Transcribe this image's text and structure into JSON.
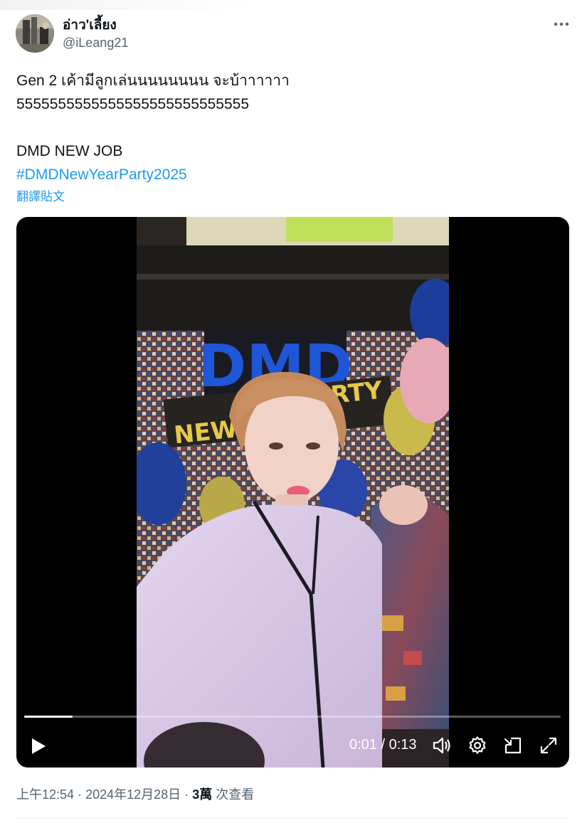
{
  "author": {
    "display_name": "อ่าว'เลี้ยง",
    "handle": "@iLeang21"
  },
  "icons": {
    "more": "more-horizontal-icon",
    "play": "play-icon",
    "volume": "volume-icon",
    "settings": "gear-icon",
    "pip": "picture-in-picture-icon",
    "fullscreen": "fullscreen-icon"
  },
  "tweet": {
    "lines": [
      "Gen 2 เค้ามีลูกเล่นนนนนนนน จะบ้าาาาาา",
      "5555555555555555555555555555",
      "",
      "DMD NEW JOB"
    ],
    "hashtag": "#DMDNewYearParty2025",
    "translate_label": "翻譯貼文"
  },
  "video": {
    "current_time": "0:01",
    "separator": "/",
    "duration": "0:13",
    "progress_fraction": 0.09,
    "scene_text": {
      "logo": "DMD",
      "banner_left": "NEW",
      "banner_right": "RTY"
    }
  },
  "meta": {
    "time": "上午12:54",
    "dot1": "·",
    "date": "2024年12月28日",
    "dot2": "·",
    "views_count": "3萬",
    "views_label": "次查看"
  },
  "colors": {
    "accent": "#1d9bf0",
    "text": "#0f1419",
    "secondary": "#536471",
    "shirt": "#d7c6e4"
  }
}
